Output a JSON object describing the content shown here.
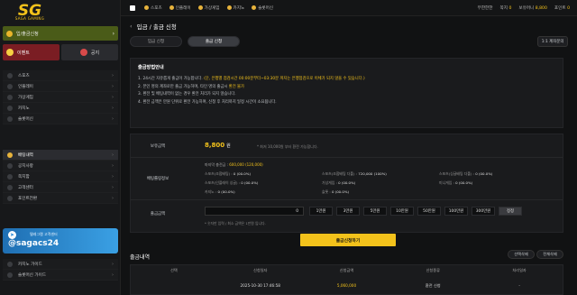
{
  "logo": {
    "brand": "SG",
    "tagline": "SAGA GAMING"
  },
  "sidebar": {
    "main_button": "입/출금신청",
    "event": "이벤트",
    "notice": "공지",
    "items": [
      {
        "label": "스포츠"
      },
      {
        "label": "인플레이"
      },
      {
        "label": "가상게임"
      },
      {
        "label": "카지노"
      },
      {
        "label": "슬롯머신"
      }
    ],
    "items2": [
      {
        "label": "배팅내역",
        "active": true
      },
      {
        "label": "공지사항"
      },
      {
        "label": "쪽지함"
      },
      {
        "label": "고객센터"
      },
      {
        "label": "포인트전환"
      }
    ],
    "banner": {
      "line1": "텔레그램 고객센터",
      "line2": "@sagacs24"
    },
    "items3": [
      {
        "label": "카지노 가이드"
      },
      {
        "label": "슬롯머신 가이드"
      }
    ]
  },
  "topbar": {
    "nav": [
      "스포츠",
      "인플레이",
      "가상게임",
      "카지노",
      "슬롯머신"
    ],
    "user": "무한한한",
    "msg_label": "쪽지",
    "msg_count": "0",
    "balance_label": "보유머니",
    "balance": "8,800",
    "point_label": "포인트",
    "point": "0"
  },
  "page": {
    "title": "입금 / 출금 신청",
    "tabs": [
      "입금 신청",
      "출금 신청"
    ],
    "help": "1:1 계좌문의"
  },
  "guide": {
    "title": "출금방법안내",
    "lines": [
      {
        "pre": "1. 24시간 자유롭게 출금이 가능합니다.",
        "hl": " (단, 은행별 점검시간 00:00분부터~03:30분 까지는 은행점검으로 이체가 되지 않을 수 있습니다.)"
      },
      {
        "pre": "2. 본인 명의 계좌로만 출금 가능하며, 타인 명의 출금시",
        "hl": " 환전 불가"
      },
      {
        "pre": "3. 환전 및 배팅내역이 없는 경우 환전 처리가 되지 않습니다.",
        "hl": ""
      },
      {
        "pre": "4. 환전 금액은 만원 단위로 환전 가능하며, 신청 후 처리까지 일정 시간이 소요됩니다.",
        "hl": ""
      }
    ]
  },
  "form": {
    "balance_label": "보유금액",
    "balance_value": "8,800",
    "balance_unit": "원",
    "balance_note": "* 최저 10,000원 부터 환전 가능합니다.",
    "rolling_label": "배팅롤링정보",
    "rolling_line_pre": "마지막 충전금 :",
    "rolling_line_val": "600,000 (120,000)",
    "grid": [
      {
        "k": "스포츠(조합배팅) :",
        "v": "0 (00.0%)"
      },
      {
        "k": "스포츠(조합배팅 다폴) :",
        "v": "720,000 (100%)"
      },
      {
        "k": "스포츠(싱글배팅 다폴) :",
        "v": "0 (00.0%)"
      },
      {
        "k": "스포츠(인플레이 싱글) :",
        "v": "0 (00.0%)"
      },
      {
        "k": "가상게임 :",
        "v": "0 (00.0%)"
      },
      {
        "k": "미니게임 :",
        "v": "0 (00.0%)"
      },
      {
        "k": "카지노 :",
        "v": "0 (00.0%)"
      },
      {
        "k": "슬롯 :",
        "v": "0 (00.0%)"
      },
      {
        "k": "",
        "v": ""
      }
    ],
    "amount_label": "출금금액",
    "amount_value": "0",
    "amount_buttons": [
      "1만원",
      "3만원",
      "5만원",
      "10만원",
      "50만원",
      "100만원",
      "300만원"
    ],
    "reset": "정정",
    "amount_note": "* 숫자만 입력 / 최소 금액은 1만원 입니다.",
    "submit": "출금신청하기"
  },
  "history": {
    "title": "출금내역",
    "btn_select": "선택삭제",
    "btn_all": "전체삭제",
    "headers": [
      "선택",
      "신청일자",
      "신청금액",
      "신청종류",
      "처리일자"
    ],
    "row": {
      "date": "2025-10-30 17:46:58",
      "amount": "5,060,000",
      "type": "환전 신청",
      "done": "-"
    }
  }
}
